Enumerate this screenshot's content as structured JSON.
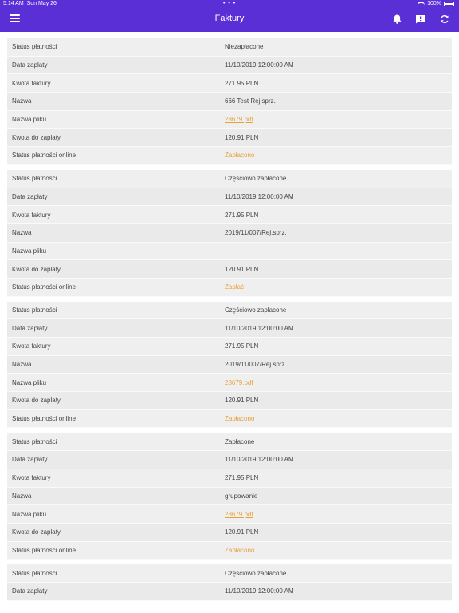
{
  "status_bar": {
    "time": "5:14 AM",
    "date": "Sun May 26",
    "dots": "• • •",
    "battery": "100%"
  },
  "header": {
    "title": "Faktury"
  },
  "icons": {
    "menu": "hamburger-icon",
    "bell": "bell-icon",
    "message": "message-alert-icon",
    "refresh": "refresh-icon"
  },
  "colors": {
    "accent": "#5b2fd6",
    "link": "#e8a13a"
  },
  "labels": {
    "status": "Status płatności",
    "date": "Data zapłaty",
    "amount": "Kwota faktury",
    "name": "Nazwa",
    "file": "Nazwa pliku",
    "due": "Kwota do zaplaty",
    "online": "Status płatności online"
  },
  "invoices": [
    {
      "status": "Niezapłacone",
      "date": "11/10/2019 12:00:00 AM",
      "amount": "271.95 PLN",
      "name": "666 Test Rej.sprz.",
      "file": "28679.pdf",
      "due": "120.91 PLN",
      "online": "Zapłacono"
    },
    {
      "status": "Częściowo zapłacone",
      "date": "11/10/2019 12:00:00 AM",
      "amount": "271.95 PLN",
      "name": "2019/11/007/Rej.sprz.",
      "file": "",
      "due": "120.91 PLN",
      "online": "Zapłać"
    },
    {
      "status": "Częściowo zapłacone",
      "date": "11/10/2019 12:00:00 AM",
      "amount": "271.95 PLN",
      "name": "2019/11/007/Rej.sprz.",
      "file": "28679.pdf",
      "due": "120.91 PLN",
      "online": "Zapłacono"
    },
    {
      "status": "Zapłacone",
      "date": "11/10/2019 12:00:00 AM",
      "amount": "271.95 PLN",
      "name": "grupowanie",
      "file": "28679.pdf",
      "due": "120.91 PLN",
      "online": "Zapłacono"
    },
    {
      "status": "Częściowo zapłacone",
      "date": "11/10/2019 12:00:00 AM"
    }
  ]
}
